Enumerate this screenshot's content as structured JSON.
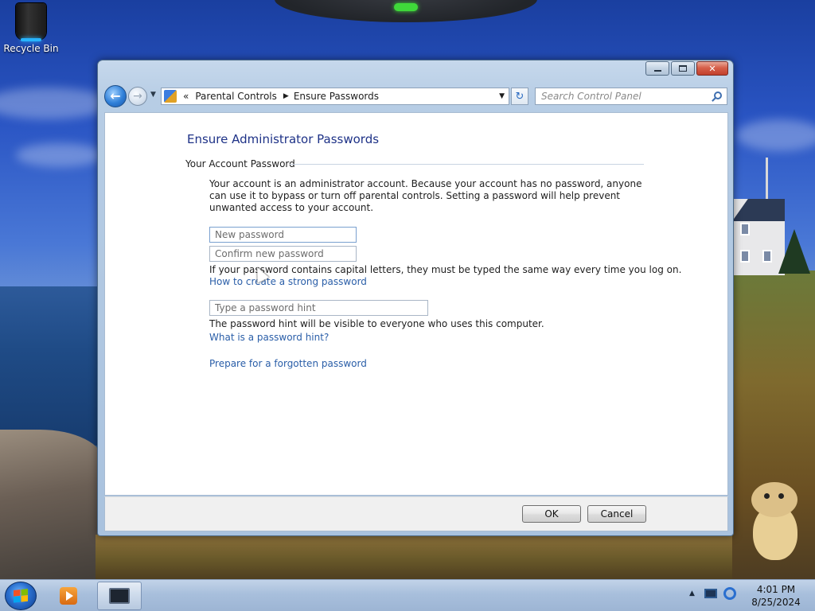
{
  "desktop": {
    "recycle_bin_label": "Recycle Bin"
  },
  "window": {
    "caption_buttons": {
      "minimize": "minimize",
      "maximize": "maximize",
      "close": "✕"
    },
    "address_bar": {
      "overflow": "«",
      "breadcrumb": [
        "Parental Controls",
        "Ensure Passwords"
      ],
      "separator": "▶",
      "dropdown": "▼"
    },
    "refresh_glyph": "↻",
    "search": {
      "placeholder": "Search Control Panel"
    },
    "content": {
      "heading": "Ensure Administrator Passwords",
      "section_title": "Your Account Password",
      "description": "Your account is an administrator account. Because your account has no password, anyone can use it to bypass or turn off parental controls. Setting a password will help prevent unwanted access to your account.",
      "new_password_placeholder": "New password",
      "confirm_password_placeholder": "Confirm new password",
      "caps_note": "If your password contains capital letters, they must be typed the same way every time you log on.",
      "strong_password_link": "How to create a strong password",
      "hint_placeholder": "Type a password hint",
      "hint_note": "The password hint will be visible to everyone who uses this computer.",
      "hint_link": "What is a password hint?",
      "forgotten_link": "Prepare for a forgotten password"
    },
    "footer": {
      "ok_label": "OK",
      "cancel_label": "Cancel"
    }
  },
  "taskbar": {
    "tray_arrow": "▲",
    "clock_time": "4:01 PM",
    "clock_date": "8/25/2024"
  },
  "colors": {
    "heading": "#1e3287",
    "link": "#2a5ea8",
    "window_frame": "#b7cde5"
  }
}
